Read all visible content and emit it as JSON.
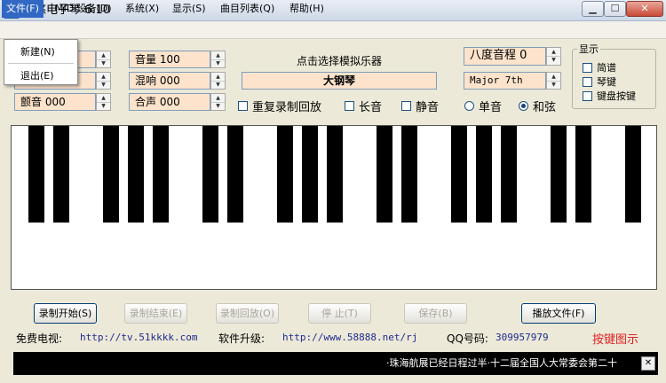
{
  "window": {
    "icon": "2P",
    "title": "悠悠电子琴 6.10",
    "minimize_glyph": "▁",
    "maximize_glyph": "☐",
    "close_glyph": "✕"
  },
  "menubar": {
    "items": [
      "文件(F)",
      "MIDI设备(D)",
      "系统(X)",
      "显示(S)",
      "曲目列表(Q)",
      "帮助(H)"
    ]
  },
  "file_menu": {
    "items": [
      "新建(N)",
      "退出(E)"
    ]
  },
  "controls": {
    "vibrato": "颤音 000",
    "volume": "音量 100",
    "reverb": "混响 000",
    "chorus": "合声 000",
    "instrument_label": "点击选择模拟乐器",
    "instrument": "大钢琴",
    "octave": "八度音程 0",
    "chord_type": "Major 7th",
    "repeat_playback": "重复录制回放",
    "sustain": "长音",
    "mute": "静音",
    "single_note": "单音",
    "chord": "和弦",
    "mode_selected": "chord"
  },
  "display_group": {
    "title": "显示",
    "items": [
      "简谱",
      "琴键",
      "键盘按键"
    ]
  },
  "piano": {
    "white_keys": 26,
    "black_key_groups": [
      "2",
      "3",
      "2",
      "3",
      "2",
      "3",
      "2"
    ]
  },
  "buttons": {
    "record_start": "录制开始(S)",
    "record_stop": "录制结束(E)",
    "record_playback": "录制回放(O)",
    "stop": "停 止(T)",
    "save": "保存(B)",
    "play_file": "播放文件(F)"
  },
  "info": {
    "free_tv_label": "免费电视:",
    "free_tv_url": "http://tv.51kkkk.com",
    "upgrade_label": "软件升级:",
    "upgrade_url": "http://www.58888.net/rj",
    "qq_label": "QQ号码:",
    "qq": "309957979",
    "key_hint": "按键图示"
  },
  "ticker": {
    "text": "·珠海航展已经日程过半·十二届全国人大常委会第二十"
  },
  "colors": {
    "field_bg": "#fde3cc",
    "menu_highlight": "#3168c3",
    "link": "#1f2a8f",
    "hint": "#e02020"
  }
}
